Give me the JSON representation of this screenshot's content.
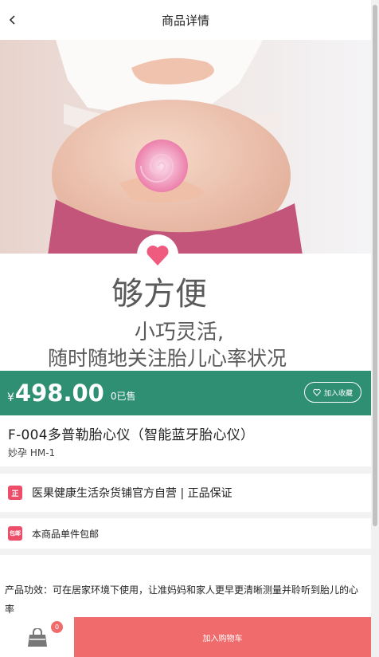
{
  "header": {
    "title": "商品详情",
    "back_icon": "chevron-left-icon"
  },
  "hero": {
    "headline": "够方便",
    "line1": "小巧灵活,",
    "line2": "随时随地关注胎儿心率状况"
  },
  "price_bar": {
    "currency": "¥",
    "price": "498.00",
    "sold": "0已售",
    "favorite_label": "加入收藏",
    "color": "#2f8f72"
  },
  "product": {
    "name": "F-004多普勒胎心仪（智能蓝牙胎心仪）",
    "subtitle": "妙孕 HM-1"
  },
  "store_info": {
    "badge": "正",
    "text": "医果健康生活杂货铺官方自营 | 正品保证"
  },
  "shipping_info": {
    "badge": "包邮",
    "text": "本商品单件包邮"
  },
  "description": {
    "text": "产品功效：可在居家环境下使用，让准妈妈和家人更早更清晰测量并聆听到胎儿的心率"
  },
  "bottom_bar": {
    "cart_count": "0",
    "add_to_cart_label": "加入购物车",
    "accent": "#f06b6b"
  }
}
